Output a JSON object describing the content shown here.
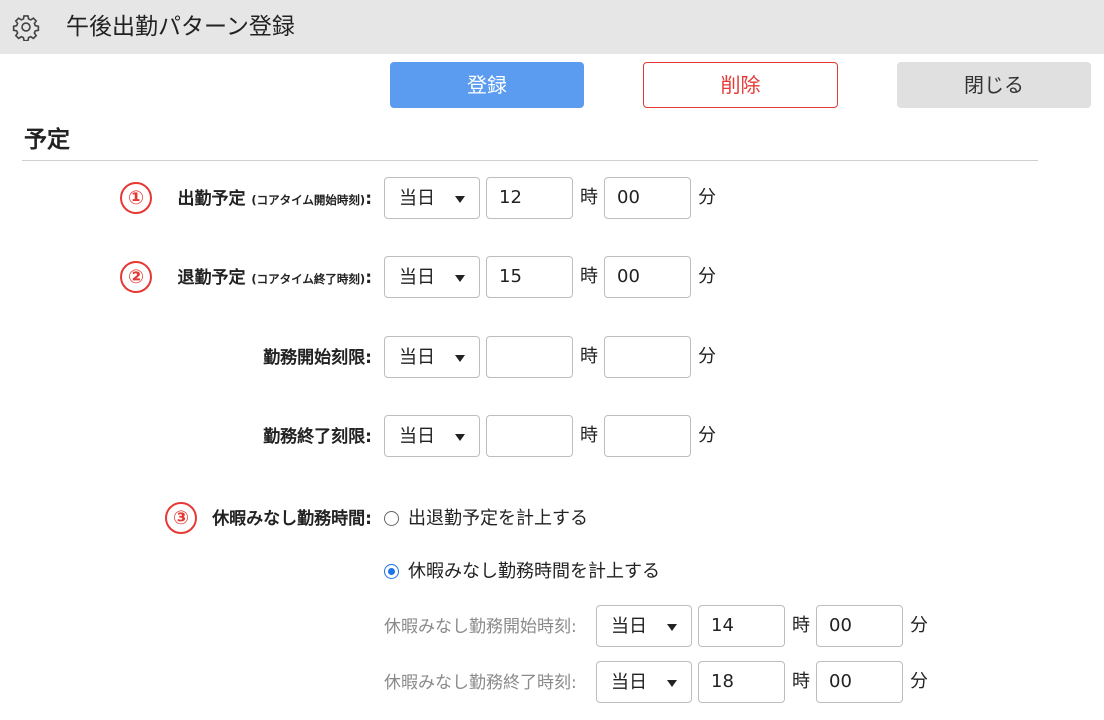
{
  "window": {
    "title": "午後出勤パターン登録",
    "icon": "gear-icon"
  },
  "toolbar": {
    "register_label": "登録",
    "delete_label": "削除",
    "close_label": "閉じる"
  },
  "section": {
    "title": "予定"
  },
  "colors": {
    "primary": "#5b9bf0",
    "danger": "#e53935",
    "radio_selected": "#1a73e8"
  },
  "rows": [
    {
      "marker": "①",
      "label": "出勤予定",
      "sublabel": "(コアタイム開始時刻)",
      "colon": ":",
      "day": "当日",
      "hour": "12",
      "minute": "00",
      "hour_unit": "時",
      "minute_unit": "分"
    },
    {
      "marker": "②",
      "label": "退勤予定",
      "sublabel": "(コアタイム終了時刻)",
      "colon": ":",
      "day": "当日",
      "hour": "15",
      "minute": "00",
      "hour_unit": "時",
      "minute_unit": "分"
    },
    {
      "label": "勤務開始刻限:",
      "day": "当日",
      "hour": "",
      "minute": "",
      "hour_unit": "時",
      "minute_unit": "分"
    },
    {
      "label": "勤務終了刻限:",
      "day": "当日",
      "hour": "",
      "minute": "",
      "hour_unit": "時",
      "minute_unit": "分"
    }
  ],
  "leave": {
    "marker": "③",
    "label": "休暇みなし勤務時間:",
    "options": [
      {
        "label": "出退勤予定を計上する",
        "selected": false
      },
      {
        "label": "休暇みなし勤務時間を計上する",
        "selected": true
      }
    ],
    "subrows": [
      {
        "label": "休暇みなし勤務開始時刻:",
        "day": "当日",
        "hour": "14",
        "minute": "00",
        "hour_unit": "時",
        "minute_unit": "分"
      },
      {
        "label": "休暇みなし勤務終了時刻:",
        "day": "当日",
        "hour": "18",
        "minute": "00",
        "hour_unit": "時",
        "minute_unit": "分"
      }
    ]
  }
}
